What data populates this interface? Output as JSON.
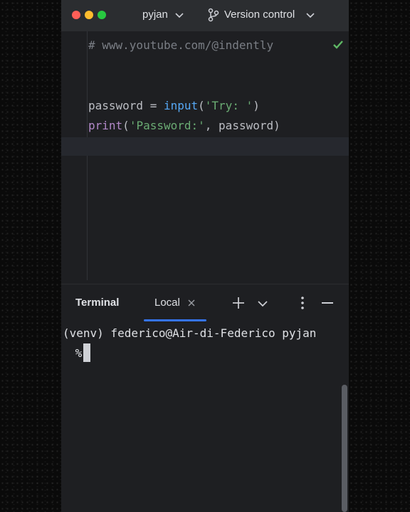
{
  "titlebar": {
    "project": "pyjan",
    "version_control": "Version control"
  },
  "editor": {
    "comment": "# www.youtube.com/@indently",
    "line1": {
      "var": "password = ",
      "fn": "input",
      "open": "(",
      "str": "'Try: '",
      "close": ")"
    },
    "line2": {
      "fn": "print",
      "open": "(",
      "str": "'Password:'",
      "rest": ", password)"
    }
  },
  "terminal": {
    "title": "Terminal",
    "tab_label": "Local",
    "prompt": "(venv) federico@Air-di-Federico pyjan",
    "prompt_symbol": " %"
  },
  "colors": {
    "accent": "#3574f0",
    "ok": "#5fb865",
    "string": "#6aab73",
    "builtin": "#b389c9",
    "call": "#56a8f5"
  },
  "icons": {
    "window_controls": [
      "close-dot",
      "minimize-dot",
      "zoom-dot"
    ],
    "branch": "git-branch-icon",
    "status": "check-icon",
    "terminal_actions": [
      "plus-icon",
      "chevron-down-icon",
      "more-vertical-icon",
      "minimize-icon"
    ]
  }
}
